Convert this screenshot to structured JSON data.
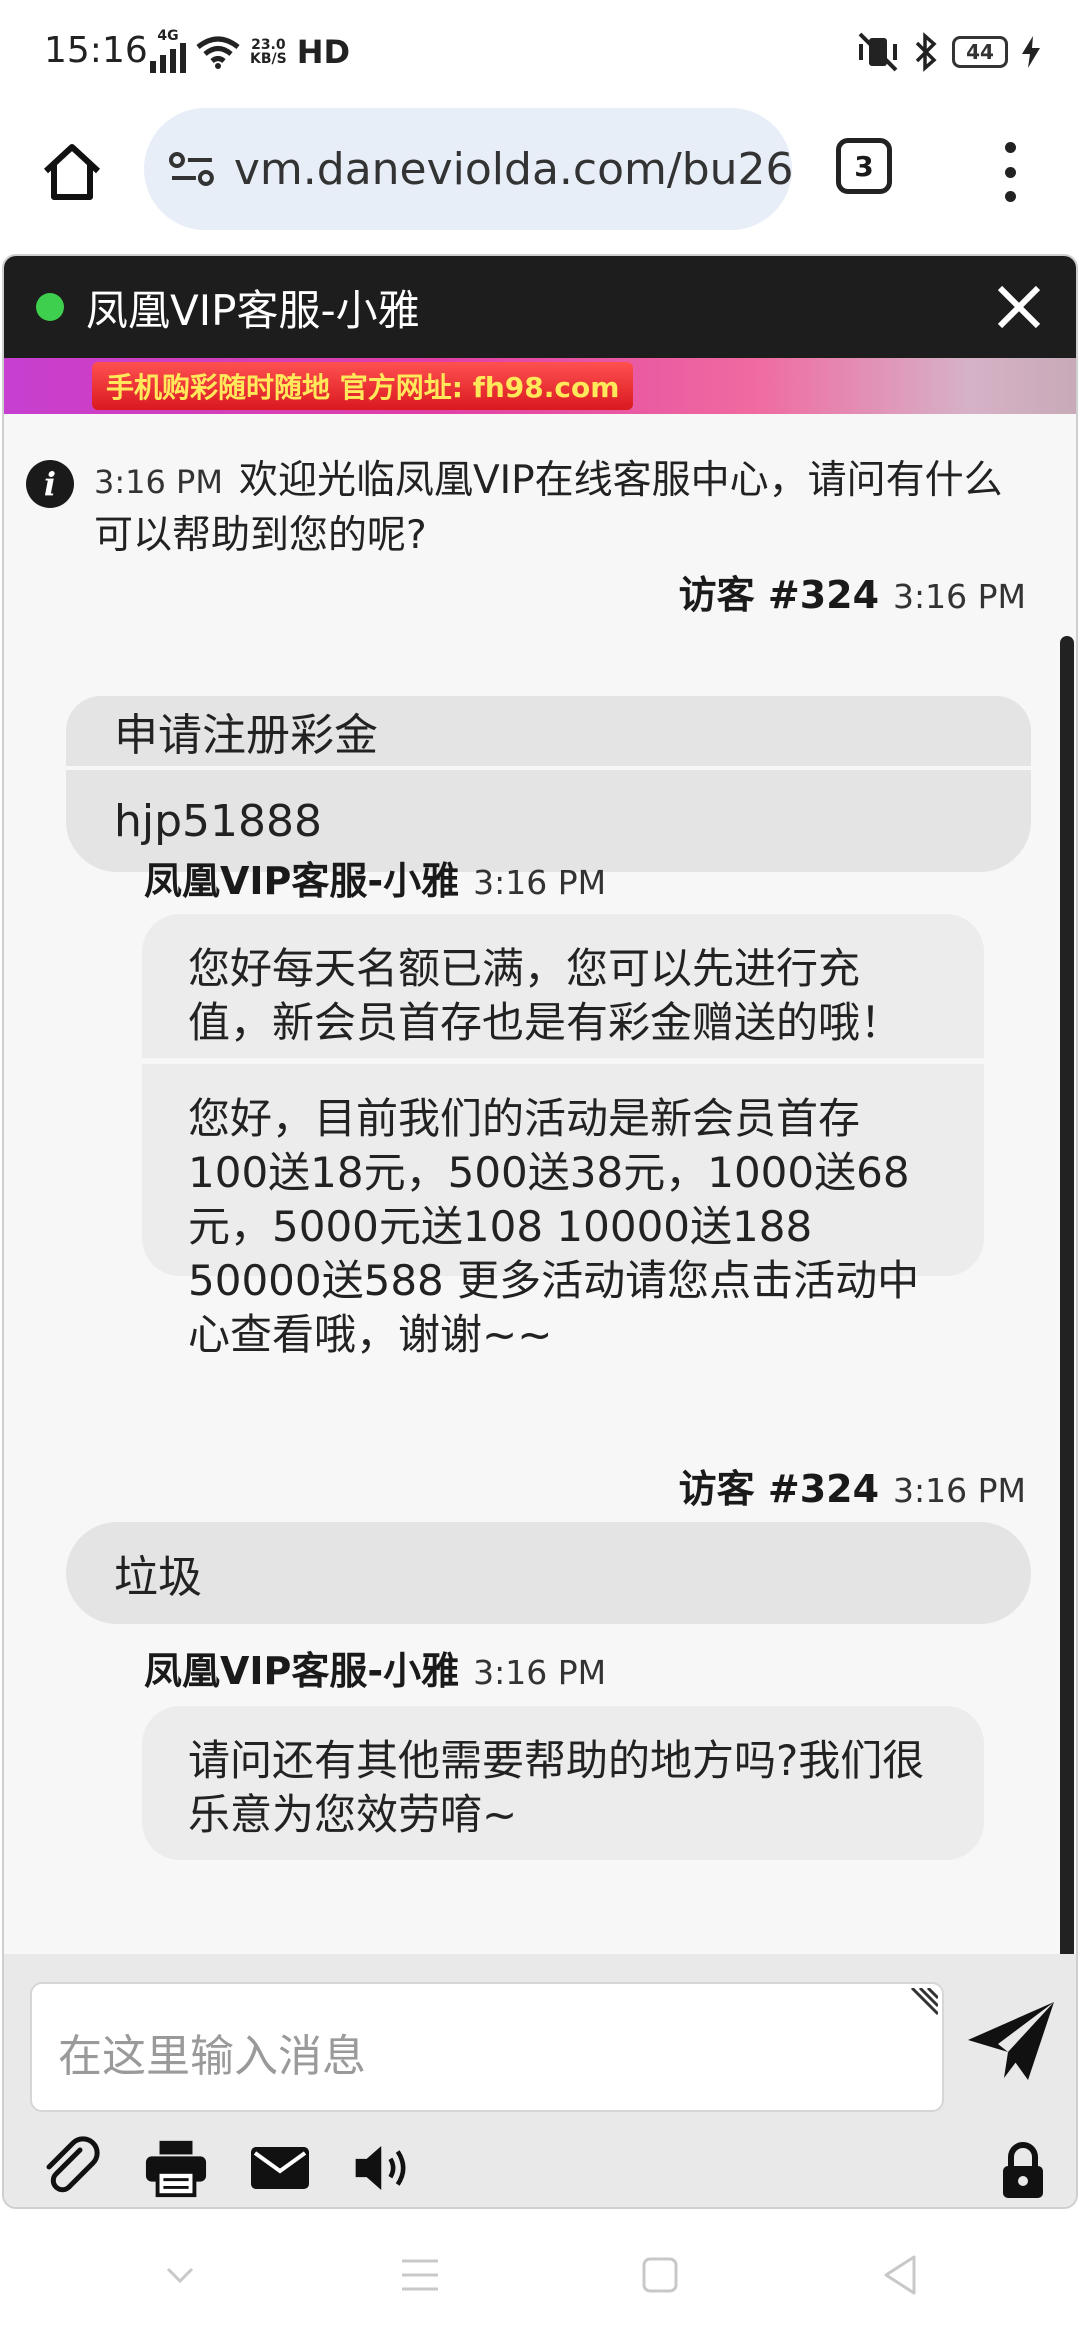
{
  "status_bar": {
    "time": "15:16",
    "network_type": "4G",
    "speed_value": "23.0",
    "speed_unit": "KB/S",
    "hd_label": "HD",
    "battery": "44"
  },
  "browser": {
    "url": "vm.daneviolda.com/bu26",
    "tab_count": "3"
  },
  "chat": {
    "title": "凤凰VIP客服-小雅",
    "banner_text": "手机购彩随时随地 官方网址: fh98.com",
    "system_message": {
      "time": "3:16 PM",
      "text": "欢迎光临凤凰VIP在线客服中心，请问有什么可以帮助到您的呢?"
    },
    "groups": [
      {
        "sender": "访客 #324",
        "time": "3:16 PM",
        "messages": [
          "申请注册彩金",
          "hjp51888"
        ]
      },
      {
        "sender": "凤凰VIP客服-小雅",
        "time": "3:16 PM",
        "messages": [
          "您好每天名额已满，您可以先进行充值，新会员首存也是有彩金赠送的哦！",
          "您好，目前我们的活动是新会员首存100送18元，500送38元，1000送68元，5000元送108 10000送188  50000送588  更多活动请您点击活动中心查看哦，谢谢~~"
        ]
      },
      {
        "sender": "访客 #324",
        "time": "3:16 PM",
        "messages": [
          "垃圾"
        ]
      },
      {
        "sender": "凤凰VIP客服-小雅",
        "time": "3:16 PM",
        "messages": [
          "请问还有其他需要帮助的地方吗?我们很乐意为您效劳唷~"
        ]
      }
    ],
    "input_placeholder": "在这里输入消息"
  },
  "icons": {
    "toolbar": [
      "attach-icon",
      "print-icon",
      "email-icon",
      "sound-icon"
    ],
    "lock": "lock-icon",
    "send": "send-icon"
  },
  "colors": {
    "header_bg": "#1d1d1d",
    "online": "#3fcf4e",
    "visitor_bubble": "#e4e4e4",
    "agent_bubble": "#ececec",
    "urlbar_bg": "#e8eef7"
  }
}
